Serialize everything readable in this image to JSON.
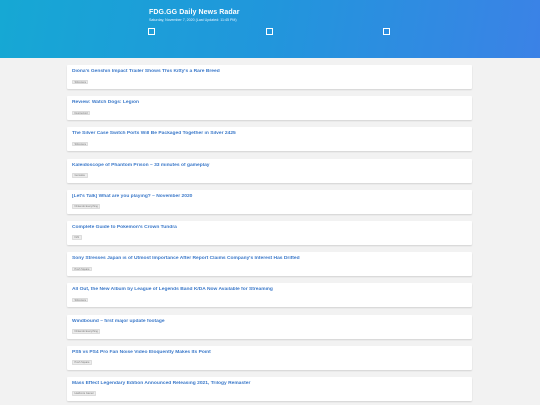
{
  "header": {
    "title": "FDG.GG Daily News Radar",
    "subtitle": "Saturday, November 7, 2020 (Last Updated: 11:45 PM)"
  },
  "items": [
    {
      "title": "Diona's Genshin Impact Trailer Shows This Kitty's a Rare Breed",
      "tag": "Siliconera"
    },
    {
      "title": "Review: Watch Dogs: Legion",
      "tag": "Destructoid"
    },
    {
      "title": "The Silver Case Switch Ports Will Be Packaged Together in Silver 2425",
      "tag": "Siliconera"
    },
    {
      "title": "Kaleidoscope of Phantom Prison – 33 minutes of gameplay",
      "tag": "Gematsu"
    },
    {
      "title": "[Let's Talk] What are you playing? – November 2020",
      "tag": "Nintendo Everything"
    },
    {
      "title": "Complete Guide to Pokemon's Crown Tundra",
      "tag": "IGN"
    },
    {
      "title": "Sony Stresses Japan is of Utmost Importance After Report Claims Company's Interest Has Drifted",
      "tag": "Push Square"
    },
    {
      "title": "All Out, the New Album by League of Legends Band K/DA Now Available for Streaming",
      "tag": "Siliconera"
    },
    {
      "title": "Windbound – first major update footage",
      "tag": "Nintendo Everything"
    },
    {
      "title": "PS5 vs PS4 Pro Fan Noise Video Eloquently Makes Its Point",
      "tag": "Push Square"
    },
    {
      "title": "Mass Effect Legendary Edition Announced Releasing 2021, Trilogy Remaster",
      "tag": "Hardcore Gamer"
    }
  ]
}
